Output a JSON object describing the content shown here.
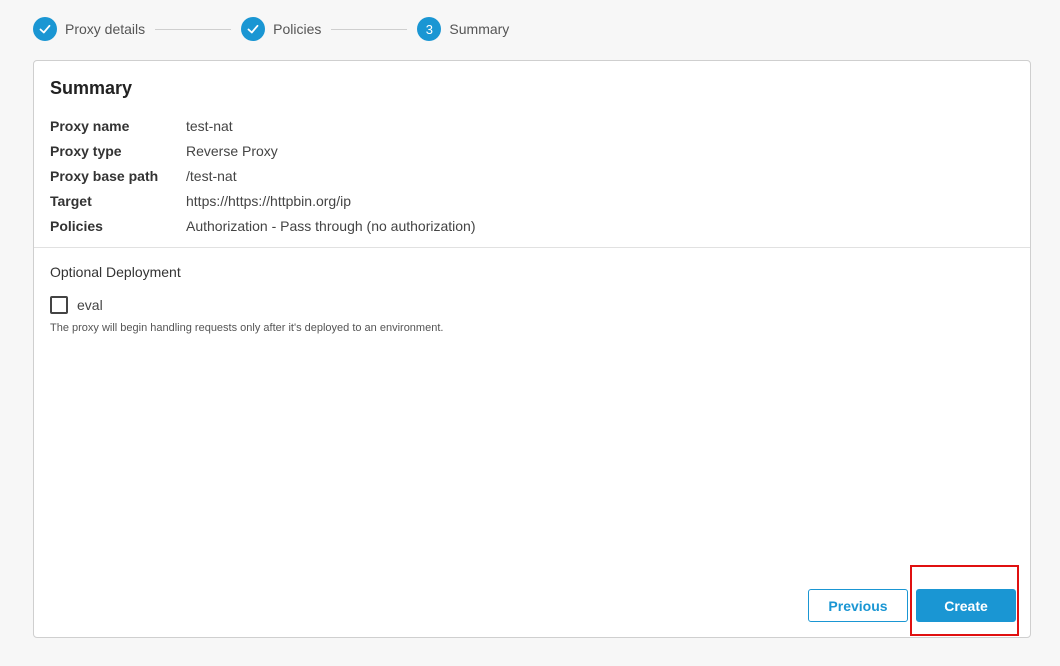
{
  "stepper": {
    "steps": [
      {
        "label": "Proxy details",
        "state": "completed",
        "marker": "check-icon"
      },
      {
        "label": "Policies",
        "state": "completed",
        "marker": "check-icon"
      },
      {
        "label": "Summary",
        "state": "current",
        "number": "3"
      }
    ]
  },
  "summary": {
    "title": "Summary",
    "rows": [
      {
        "key": "Proxy name",
        "value": "test-nat"
      },
      {
        "key": "Proxy type",
        "value": "Reverse Proxy"
      },
      {
        "key": "Proxy base path",
        "value": "/test-nat"
      },
      {
        "key": "Target",
        "value": "https://https://httpbin.org/ip"
      },
      {
        "key": "Policies",
        "value": "Authorization - Pass through (no authorization)"
      }
    ]
  },
  "deployment": {
    "heading": "Optional Deployment",
    "environment_label": "eval",
    "environment_checked": false,
    "hint": "The proxy will begin handling requests only after it's deployed to an environment."
  },
  "actions": {
    "previous_label": "Previous",
    "create_label": "Create"
  },
  "colors": {
    "accent": "#1a96d3",
    "highlight": "#e01010"
  }
}
